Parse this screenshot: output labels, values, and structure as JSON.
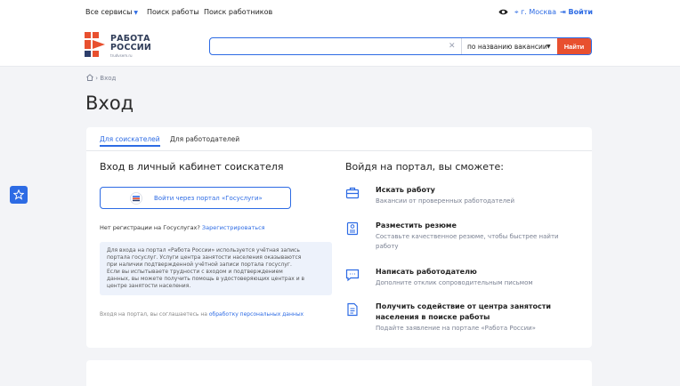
{
  "topbar": {
    "all_services": "Все сервисы",
    "job_search": "Поиск работы",
    "employee_search": "Поиск работников",
    "city": "г. Москва",
    "login": "Войти"
  },
  "logo": {
    "line1": "РАБОТА",
    "line2": "РОССИИ",
    "sub": "trudvsem.ru"
  },
  "search": {
    "value": "",
    "placeholder": "",
    "scope": "по названию вакансии",
    "button": "Найти"
  },
  "breadcrumb": {
    "current": "Вход"
  },
  "page_title": "Вход",
  "tabs": [
    {
      "label": "Для соискателей",
      "active": true
    },
    {
      "label": "Для работодателей",
      "active": false
    }
  ],
  "login_panel": {
    "title": "Вход в личный кабинет соискателя",
    "gosuslugi_button": "Войти через портал «Госуслуги»",
    "no_registration": "Нет регистрации на Госуслугах?",
    "register_link": "Зарегистрироваться",
    "info_lines": [
      "Для входа на портал «Работа России» используется учётная запись",
      "портала госуслуг. Услуги центра занятости населения оказываются",
      "при наличии подтвержденной учётной записи портала госуслуг.",
      "Если вы испытываете трудности с входом и подтверждением",
      "данных, вы можете получить помощь в удостоверяющих центрах и в",
      "центре занятости населения."
    ],
    "consent_text": "Входя на портал, вы соглашаетесь на",
    "consent_link": "обработку персональных данных"
  },
  "features_panel": {
    "title": "Войдя на портал, вы сможете:",
    "items": [
      {
        "icon": "briefcase-icon",
        "title_lines": [
          "Искать работу"
        ],
        "desc_lines": [
          "Вакансии от проверенных работодателей"
        ]
      },
      {
        "icon": "resume-icon",
        "title_lines": [
          "Разместить резюме"
        ],
        "desc_lines": [
          "Составьте качественное резюме, чтобы быстрее найти",
          "работу"
        ]
      },
      {
        "icon": "message-icon",
        "title_lines": [
          "Написать работодателю"
        ],
        "desc_lines": [
          "Дополните отклик сопроводительным письмом"
        ]
      },
      {
        "icon": "document-icon",
        "title_lines": [
          "Получить содействие от центра занятости",
          "населения в поиске работы"
        ],
        "desc_lines": [
          "Подайте заявление на портале «Работа России»"
        ]
      }
    ]
  },
  "colors": {
    "accent": "#2d6be4",
    "brand_orange": "#e8502f",
    "background": "#f3f4f7"
  }
}
